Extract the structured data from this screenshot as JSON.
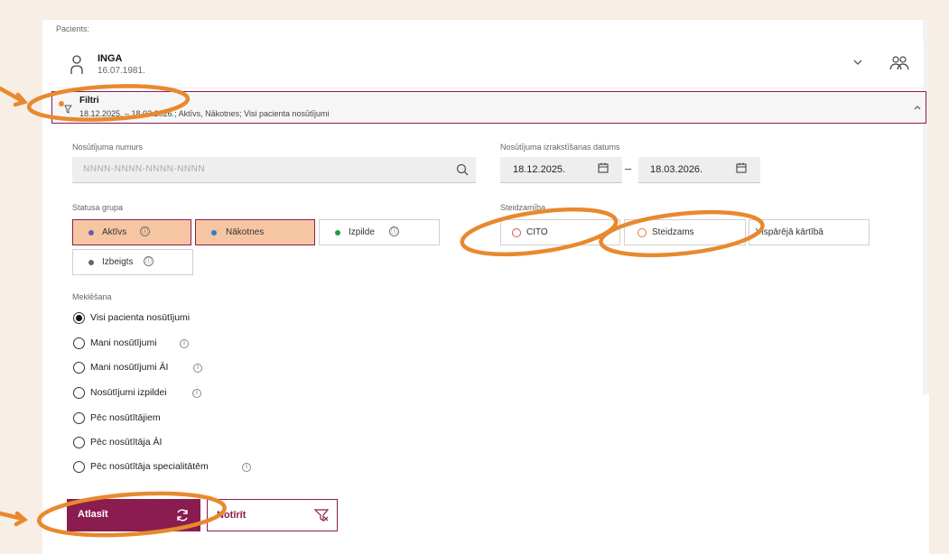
{
  "patient": {
    "section_label": "Pacients:",
    "name": "INGA",
    "dob": "16.07.1981."
  },
  "filter": {
    "title": "Filtri",
    "summary": "18.12.2025. – 18.03.2026.; Aktīvs, Nākotnes; Visi pacienta nosūtījumi"
  },
  "referral_number": {
    "label": "Nosūtījuma numurs",
    "placeholder": "NNNN-NNNN-NNNN-NNNN"
  },
  "issue_date": {
    "label": "Nosūtījuma izrakstīšanas datums",
    "from": "18.12.2025.",
    "separator": "–",
    "to": "18.03.2026."
  },
  "status_group": {
    "label": "Statusa grupa",
    "chips": [
      {
        "label": "Aktīvs",
        "dot_color": "#6b5bb5",
        "selected": true,
        "info": "ⓘ"
      },
      {
        "label": "Nākotnes",
        "dot_color": "#2e7bd6",
        "selected": true
      },
      {
        "label": "Izpilde",
        "dot_color": "#1a9e4a",
        "selected": false,
        "info": "ⓘ"
      },
      {
        "label": "Izbeigts",
        "dot_color": "#666666",
        "selected": false,
        "info": "ⓘ"
      }
    ]
  },
  "urgency": {
    "label": "Steidzamība",
    "options": [
      {
        "label": "CITO",
        "icon": "cito-icon",
        "color": "#d9534f"
      },
      {
        "label": "Steidzams",
        "icon": "urgent-icon",
        "color": "#e0783a"
      },
      {
        "label": "Vispārējā kārtībā"
      }
    ]
  },
  "search": {
    "label": "Meklēšana",
    "options": [
      {
        "label": "Visi pacienta nosūtījumi",
        "checked": true,
        "info": false
      },
      {
        "label": "Mani nosūtījumi",
        "checked": false,
        "info": true
      },
      {
        "label": "Mani nosūtījumi ĀI",
        "checked": false,
        "info": true
      },
      {
        "label": "Nosūtījumi izpildei",
        "checked": false,
        "info": true
      },
      {
        "label": "Pēc nosūtītājiem",
        "checked": false,
        "info": false
      },
      {
        "label": "Pēc nosūtītāja ĀI",
        "checked": false,
        "info": false
      },
      {
        "label": "Pēc nosūtītāja specialitātēm",
        "checked": false,
        "info": true
      }
    ]
  },
  "actions": {
    "select_label": "Atlasīt",
    "clear_label": "Notīrīt"
  },
  "colors": {
    "brand": "#8b1c4f",
    "selected_chip": "#f6c6a3",
    "annotation_orange": "#e8892e",
    "background": "#f7eee5"
  }
}
